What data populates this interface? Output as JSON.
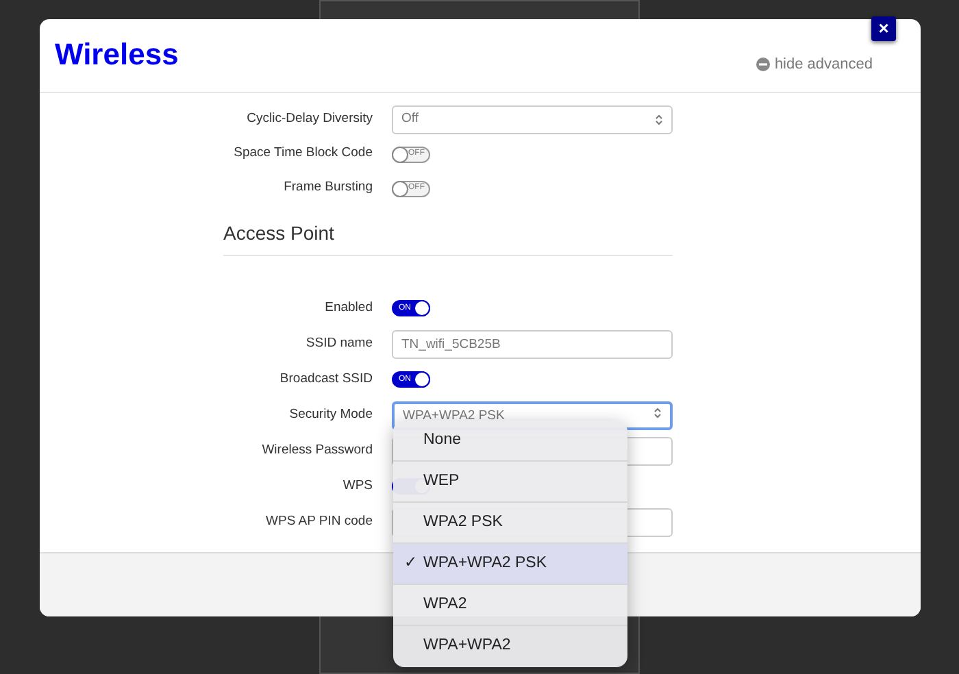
{
  "modal": {
    "title": "Wireless",
    "advanced_link": "hide advanced",
    "close": "×"
  },
  "fields": [
    {
      "kind": "select",
      "label": "Cyclic-Delay Diversity",
      "value": "Off",
      "focused": false
    },
    {
      "kind": "toggle",
      "label": "Space Time Block Code",
      "on": false,
      "text": "OFF"
    },
    {
      "kind": "toggle",
      "label": "Frame Bursting",
      "on": false,
      "text": "OFF"
    },
    {
      "kind": "heading",
      "label": "Access Point"
    },
    {
      "kind": "toggle",
      "label": "Enabled",
      "on": true,
      "text": "ON"
    },
    {
      "kind": "text",
      "label": "SSID name",
      "value": "TN_wifi_5CB25B"
    },
    {
      "kind": "toggle",
      "label": "Broadcast SSID",
      "on": true,
      "text": "ON"
    },
    {
      "kind": "select",
      "label": "Security Mode",
      "value": "WPA+WPA2 PSK",
      "focused": true
    },
    {
      "kind": "text",
      "label": "Wireless Password"
    },
    {
      "kind": "toggle",
      "label": "WPS",
      "on": true
    },
    {
      "kind": "text",
      "label": "WPS AP PIN code"
    }
  ],
  "dropdown": {
    "check": "✓",
    "options": [
      {
        "label": "None",
        "selected": false
      },
      {
        "label": "WEP",
        "selected": false
      },
      {
        "label": "WPA2 PSK",
        "selected": false
      },
      {
        "label": "WPA+WPA2 PSK",
        "selected": true
      },
      {
        "label": "WPA2",
        "selected": false
      },
      {
        "label": "WPA+WPA2",
        "selected": false
      }
    ]
  }
}
